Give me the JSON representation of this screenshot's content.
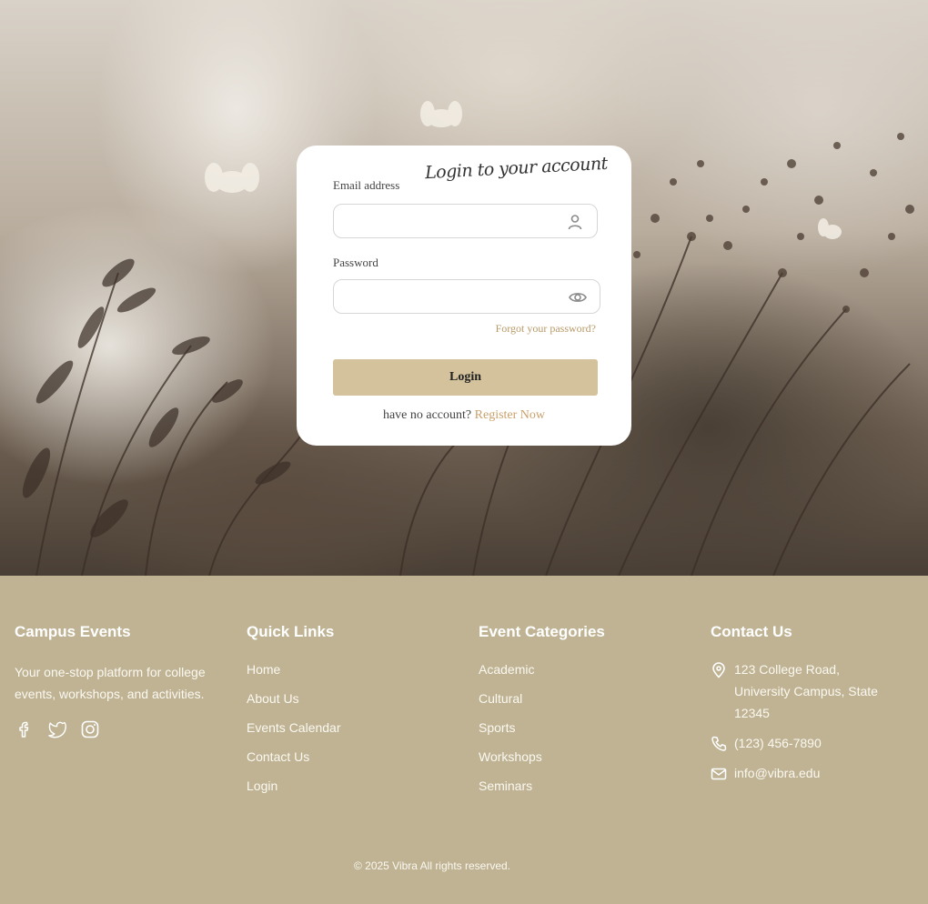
{
  "login": {
    "title": "Login to your account",
    "email_label": "Email address",
    "email_value": "",
    "password_label": "Password",
    "password_value": "",
    "forgot_link": "Forgot your password?",
    "login_button": "Login",
    "no_account_text": "have no account?",
    "register_link": "Register Now",
    "icons": {
      "email": "user-icon",
      "password": "eye-icon"
    }
  },
  "footer": {
    "about": {
      "heading": "Campus Events",
      "description": "Your one-stop platform for college events, workshops, and activities.",
      "socials": [
        "facebook-icon",
        "twitter-icon",
        "instagram-icon"
      ]
    },
    "quick_links": {
      "heading": "Quick Links",
      "items": [
        "Home",
        "About Us",
        "Events Calendar",
        "Contact Us",
        "Login"
      ]
    },
    "categories": {
      "heading": "Event Categories",
      "items": [
        "Academic",
        "Cultural",
        "Sports",
        "Workshops",
        "Seminars"
      ]
    },
    "contact": {
      "heading": "Contact Us",
      "address": "123 College Road, University Campus, State 12345",
      "phone": "(123) 456-7890",
      "email": "info@vibra.edu"
    },
    "copyright": "© 2025  Vibra All rights reserved."
  },
  "colors": {
    "footer_bg": "#bfb394",
    "button_bg": "#d3c29c",
    "link_accent": "#c9a06b",
    "forgot_accent": "#b79a67"
  }
}
